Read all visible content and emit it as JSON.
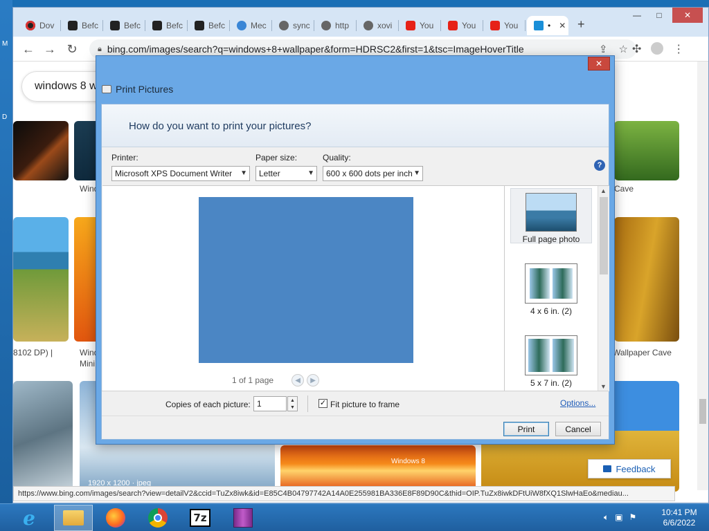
{
  "desktop": {
    "edge_letters": [
      "M",
      "D"
    ]
  },
  "browser": {
    "tabs": [
      {
        "label": "Dov",
        "icon": "download-icon"
      },
      {
        "label": "Befc",
        "icon": "shield-icon"
      },
      {
        "label": "Befc",
        "icon": "shield-icon"
      },
      {
        "label": "Befc",
        "icon": "shield-icon"
      },
      {
        "label": "Befc",
        "icon": "shield-icon"
      },
      {
        "label": "Mec",
        "icon": "cloud-icon"
      },
      {
        "label": "sync",
        "icon": "globe-icon"
      },
      {
        "label": "http",
        "icon": "globe-icon"
      },
      {
        "label": "xovi",
        "icon": "globe-icon"
      },
      {
        "label": "You",
        "icon": "youtube-icon"
      },
      {
        "label": "You",
        "icon": "youtube-icon"
      },
      {
        "label": "You",
        "icon": "youtube-icon"
      },
      {
        "label": "•",
        "icon": "bing-icon",
        "active": true
      }
    ],
    "new_tab_glyph": "+",
    "window_controls": {
      "minimize": "—",
      "maximize": "□",
      "close": "✕"
    },
    "url": "bing.com/images/search?q=windows+8+wallpaper&form=HDRSC2&first=1&tsc=ImageHoverTitle",
    "search_box_text": "windows 8 w",
    "status_url": "https://www.bing.com/images/search?view=detailV2&ccid=TuZx8iwk&id=E85C4B04797742A14A0E255981BA336E8F89D90C&thid=OIP.TuZx8iwkDFtUiW8fXQ1SlwHaEo&mediau..."
  },
  "results": {
    "captions": {
      "c1": "Wind",
      "c2": "Cave",
      "c3": "8102 DP) |",
      "c4": "Wind",
      "c5": "Mini",
      "c6": "Wallpaper Cave"
    },
    "image_overlay_text": "1920 x 1200 · jpeg",
    "banner_text": "Windows 8",
    "feedback_label": "Feedback"
  },
  "dialog": {
    "title": "Print Pictures",
    "close_glyph": "✕",
    "question": "How do you want to print your pictures?",
    "printer": {
      "label": "Printer:",
      "value": "Microsoft XPS Document Writer"
    },
    "paper_size": {
      "label": "Paper size:",
      "value": "Letter"
    },
    "quality": {
      "label": "Quality:",
      "value": "600 x 600 dots per inch"
    },
    "help_glyph": "?",
    "pager_text": "1 of 1 page",
    "layouts": [
      {
        "label": "Full page photo",
        "selected": true
      },
      {
        "label": "4 x 6 in. (2)",
        "selected": false
      },
      {
        "label": "5 x 7 in. (2)",
        "selected": false
      }
    ],
    "copies_label": "Copies of each picture:",
    "copies_value": "1",
    "fit_label": "Fit picture to frame",
    "fit_checked": true,
    "options_link": "Options...",
    "print_button": "Print",
    "cancel_button": "Cancel"
  },
  "taskbar": {
    "apps": [
      {
        "name": "internet-explorer",
        "active": false
      },
      {
        "name": "file-explorer",
        "active": true
      },
      {
        "name": "firefox",
        "active": false
      },
      {
        "name": "chrome",
        "active": false
      },
      {
        "name": "7zip",
        "active": false
      },
      {
        "name": "winrar",
        "active": false
      }
    ],
    "clock_time": "10:41 PM",
    "clock_date": "6/6/2022"
  },
  "colors": {
    "dialog_frame": "#6aa8e6",
    "preview_fill": "#4b86c4",
    "taskbar": "#2c78bf"
  }
}
